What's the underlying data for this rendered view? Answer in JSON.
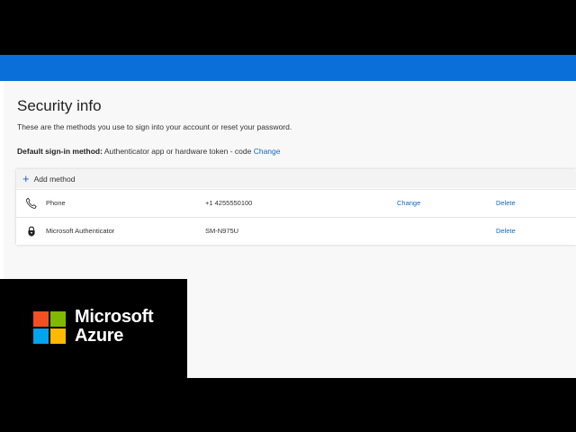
{
  "page": {
    "title": "Security info",
    "subtitle": "These are the methods you use to sign into your account or reset your password.",
    "default_method_label": "Default sign-in method:",
    "default_method_value": "Authenticator app or hardware token - code",
    "default_method_change": "Change"
  },
  "methods": {
    "add_label": "Add method",
    "items": [
      {
        "icon": "phone-icon",
        "name": "Phone",
        "detail": "+1 4255550100",
        "change": "Change",
        "delete": "Delete"
      },
      {
        "icon": "lock-icon",
        "name": "Microsoft Authenticator",
        "detail": "SM-N975U",
        "change": "",
        "delete": "Delete"
      }
    ]
  },
  "brand": {
    "line1": "Microsoft",
    "line2": "Azure"
  },
  "colors": {
    "topbar": "#0a6fd8",
    "link": "#1368c0",
    "logo_red": "#f25022",
    "logo_green": "#7fba00",
    "logo_blue": "#00a4ef",
    "logo_yellow": "#ffb900"
  }
}
